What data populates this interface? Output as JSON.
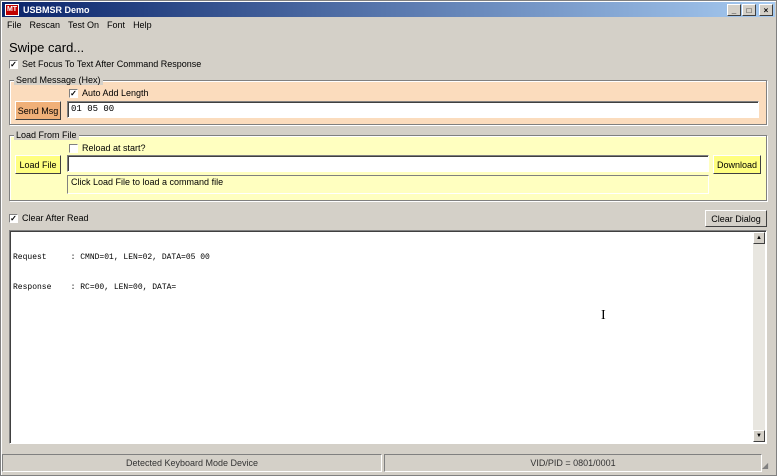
{
  "window": {
    "title": "USBMSR Demo",
    "icon_label": "MT",
    "controls": {
      "minimize": "_",
      "maximize": "□",
      "close": "×"
    }
  },
  "menu": [
    "File",
    "Rescan",
    "Test On",
    "Font",
    "Help"
  ],
  "status_heading": "Swipe card...",
  "set_focus": {
    "label": "Set Focus To Text After Command Response",
    "checked": true
  },
  "send_message": {
    "legend": "Send Message (Hex)",
    "auto_add_length": {
      "label": "Auto Add Length",
      "checked": true
    },
    "button": "Send Msg",
    "value": "01 05 00"
  },
  "load_from_file": {
    "legend": "Load From File",
    "reload": {
      "label": "Reload at start?",
      "checked": false
    },
    "load_button": "Load File",
    "download_button": "Download",
    "file_value": "",
    "hint": "Click Load File to load a command file"
  },
  "clear_after_read": {
    "label": "Clear After Read",
    "checked": true
  },
  "clear_dialog_button": "Clear Dialog",
  "output": {
    "lines": [
      "Request     : CMND=01, LEN=02, DATA=05 00",
      "Response    : RC=00, LEN=00, DATA="
    ]
  },
  "statusbar": {
    "left": "Detected Keyboard Mode Device",
    "right": "VID/PID = 0801/0001"
  },
  "colors": {
    "send_group_bg": "#fbdcbd",
    "load_group_bg": "#ffffc0",
    "send_button_bg": "#f0b078",
    "load_button_bg": "#ffff80"
  }
}
